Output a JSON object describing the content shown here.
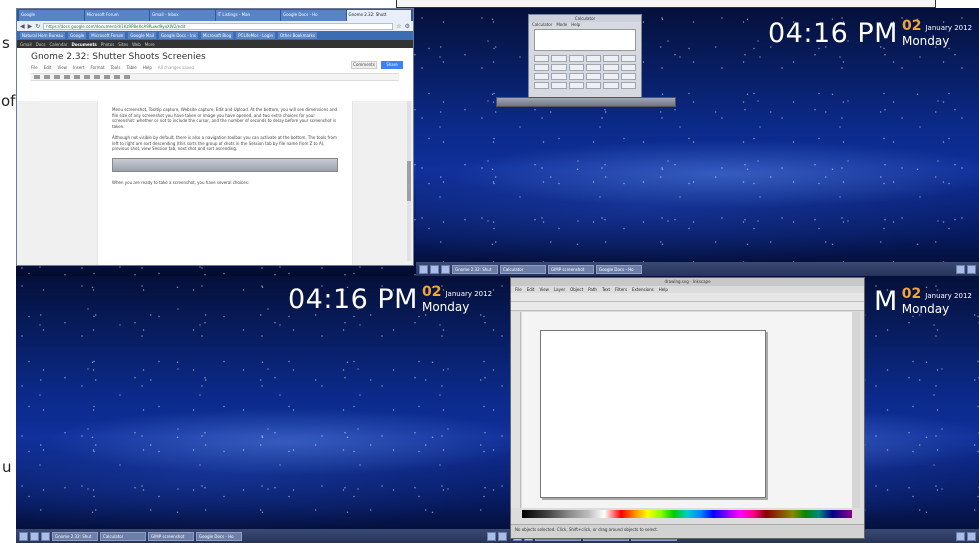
{
  "side_text": {
    "s": "s",
    "of": "of",
    "u": "u"
  },
  "clock": {
    "time": "04:16 PM",
    "day": "02",
    "month": "January 2012",
    "weekday": "Monday"
  },
  "browser": {
    "tabs": [
      "Google",
      "Microsoft Forum",
      "Gmail - Inbox",
      "IT Listings - Man",
      "Google Docs - Ho",
      "Gnome 2.32: Shutt"
    ],
    "url": "https://docs.google.com/document/d/1Kz9P8eXcA9Ruwd9yeXW2/edit",
    "bookmarks": [
      "Natural Horn Bureau",
      "Google",
      "Microsoft Forum",
      "Google Mail",
      "Google Docs - Ins",
      "Microsoft Blog",
      "PCLifeMor - Login",
      "Other Bookmarks"
    ],
    "appbar": [
      "Gmail",
      "Docs",
      "Calendar",
      "Documents",
      "Photos",
      "Sites",
      "Web",
      "More"
    ],
    "doc_title": "Gnome 2.32: Shutter Shoots Screenies",
    "doc_menu": [
      "File",
      "Edit",
      "View",
      "Insert",
      "Format",
      "Tools",
      "Table",
      "Help",
      "All changes saved"
    ],
    "comments_label": "Comments",
    "share_label": "Share",
    "paragraphs": [
      "Menu screenshot, Tooltip capture, Website capture, Edit and Upload. At the bottom, you will see dimensions and file size of any screenshot you have taken or image you have opened, and two extra choices for your screenshot: whether or not to include the cursor, and the number of seconds to delay before your screenshot is taken.",
      "Although not visible by default, there is also a navigation toolbar you can activate at the bottom. The tools from left to right are sort descending (this sorts the group of shots in the Session tab by file name from Z to A), previous shot, view Session tab, next shot and sort ascending.",
      "When you are ready to take a screenshot, you have several choices:"
    ]
  },
  "calculator": {
    "title": "Calculator",
    "menu": [
      "Calculator",
      "Mode",
      "Help"
    ]
  },
  "inkscape": {
    "title": "drawing.svg - Inkscape",
    "menu": [
      "File",
      "Edit",
      "View",
      "Layer",
      "Object",
      "Path",
      "Text",
      "Filters",
      "Extensions",
      "Help"
    ],
    "status": "No objects selected. Click, Shift+click, or drag around objects to select."
  },
  "taskbar": {
    "tasks": [
      "Gnome 2.32: Shut",
      "Calculator",
      "GIMP screenshot",
      "Google Docs - Ho"
    ]
  }
}
